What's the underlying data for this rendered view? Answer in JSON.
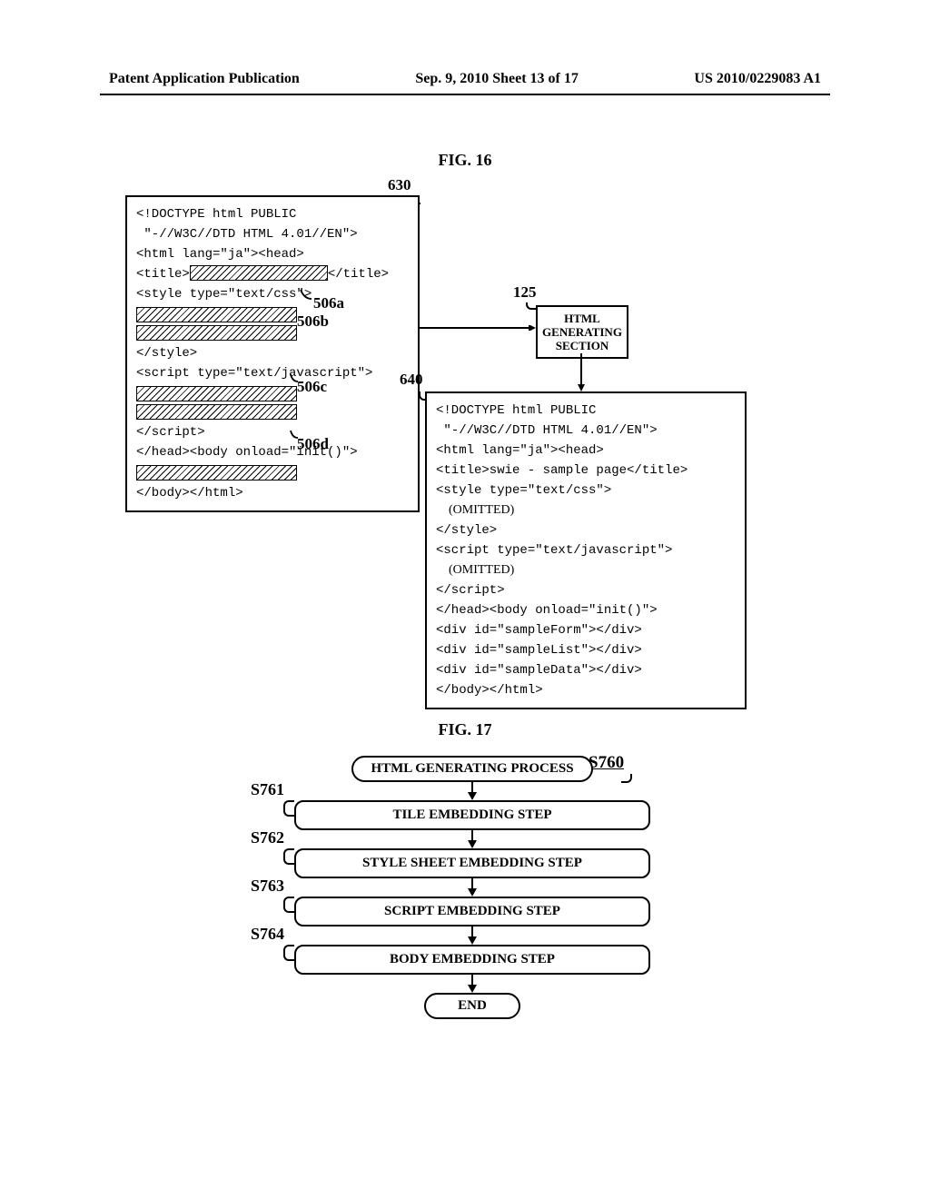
{
  "header": {
    "left": "Patent Application Publication",
    "center": "Sep. 9, 2010   Sheet 13 of 17",
    "right": "US 2010/0229083 A1"
  },
  "fig16": {
    "title": "FIG. 16",
    "ref_630": "630",
    "ref_640": "640",
    "ref_125": "125",
    "ref_506a": "506a",
    "ref_506b": "506b",
    "ref_506c": "506c",
    "ref_506d": "506d",
    "html_gen_box_l1": "HTML",
    "html_gen_box_l2": "GENERATING",
    "html_gen_box_l3": "SECTION",
    "left_lines": [
      "<!DOCTYPE html PUBLIC",
      " \"-//W3C//DTD HTML 4.01//EN\">",
      "<html lang=\"ja\"><head>",
      "<title>",
      "</title>",
      "<style type=\"text/css\">",
      "</style>",
      "<script type=\"text/javascript\">",
      "</scr​ipt>",
      "</head><body onload=\"init()\">",
      "</body></html>"
    ],
    "right_lines": [
      "<!DOCTYPE html PUBLIC",
      " \"-//W3C//DTD HTML 4.01//EN\">",
      "<html lang=\"ja\"><head>",
      "<title>swie - sample page</title>",
      "<style type=\"text/css\">",
      "(OMITTED)",
      "</style>",
      "<script type=\"text/javascript\">",
      "(OMITTED)",
      "</scr​ipt>",
      "</head><body onload=\"init()\">",
      "<div id=\"sampleForm\"></div>",
      "<div id=\"sampleList\"></div>",
      "<div id=\"sampleData\"></div>",
      "</body></html>"
    ]
  },
  "fig17": {
    "title": "FIG. 17",
    "s760": "S760",
    "start": "HTML GENERATING PROCESS",
    "steps": [
      {
        "label": "S761",
        "text": "TILE EMBEDDING STEP"
      },
      {
        "label": "S762",
        "text": "STYLE SHEET EMBEDDING STEP"
      },
      {
        "label": "S763",
        "text": "SCRIPT EMBEDDING STEP"
      },
      {
        "label": "S764",
        "text": "BODY EMBEDDING STEP"
      }
    ],
    "end": "END"
  }
}
